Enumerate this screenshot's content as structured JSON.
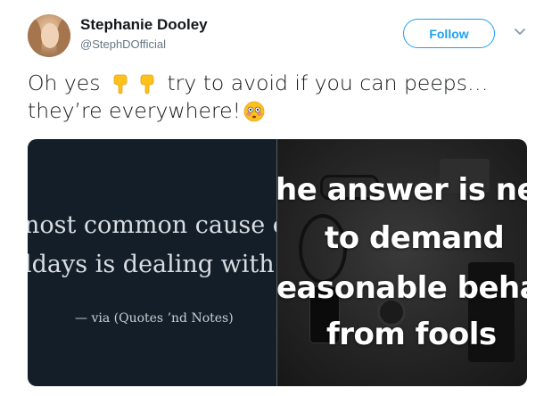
{
  "author": {
    "name": "Stephanie Dooley",
    "handle": "@StephDOfficial"
  },
  "header": {
    "follow_label": "Follow",
    "menu_icon": "chevron-down-icon"
  },
  "tweet": {
    "text_part1": "Oh yes",
    "text_part2": "try to avoid if you can peeps…",
    "text_part3": "they’re everywhere!",
    "emojis": [
      "backhand-index-pointing-down",
      "backhand-index-pointing-down",
      "flushed-face"
    ]
  },
  "media": {
    "left_image": {
      "line1": "nost common cause o",
      "line2": "ldays is dealing with",
      "attribution": "— via (Quotes ’nd Notes)"
    },
    "right_image": {
      "line1": "he answer is nev",
      "line2": "to demand",
      "line3": "easonable behav",
      "line4": "from fools"
    }
  },
  "colors": {
    "accent": "#1da1f2",
    "text": "#14171a",
    "muted": "#657786"
  }
}
